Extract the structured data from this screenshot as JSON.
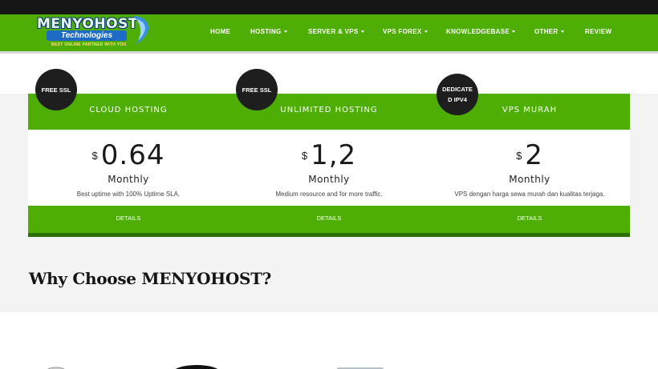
{
  "logo": {
    "title": "MENYOHOST",
    "subtitle": "Technologies",
    "tagline": "BEST ONLINE PARTNER WITH YOU"
  },
  "nav": {
    "items": [
      {
        "label": "HOME"
      },
      {
        "label": "HOSTING",
        "dropdown": true
      },
      {
        "label": "SERVER & VPS",
        "dropdown": true
      },
      {
        "label": "VPS FOREX",
        "dropdown": true
      },
      {
        "label": "KNOWLEDGEBASE",
        "dropdown": true
      },
      {
        "label": "OTHER",
        "dropdown": true
      },
      {
        "label": "REVIEW"
      }
    ]
  },
  "plans": [
    {
      "badge": "FREE SSL",
      "name": "CLOUD HOSTING",
      "currency": "$",
      "price": "0.64",
      "period": "Monthly",
      "description": "Best uptime with 100% Uptime SLA.",
      "cta": "DETAILS"
    },
    {
      "badge": "FREE SSL",
      "name": "UNLIMITED HOSTING",
      "currency": "$",
      "price": "1,2",
      "period": "Monthly",
      "description": "Medium resource and for more traffic.",
      "cta": "DETAILS"
    },
    {
      "badge": "DEDICATE D IPV4",
      "name": "VPS MURAH",
      "currency": "$",
      "price": "2",
      "period": "Monthly",
      "description": "VPS dengan harga sewa murah dan kualitas terjaga.",
      "cta": "DETAILS"
    }
  ],
  "why": {
    "title": "Why Choose MENYOHOST?"
  },
  "colors": {
    "brand_green": "#4eae04",
    "dark_green": "#2c7003",
    "topbar": "#161616",
    "badge": "#1e1e1e"
  },
  "icons": [
    "swirl-logo-icon",
    "caret-down-icon",
    "feature-icon-1",
    "feature-icon-2",
    "feature-icon-3"
  ]
}
